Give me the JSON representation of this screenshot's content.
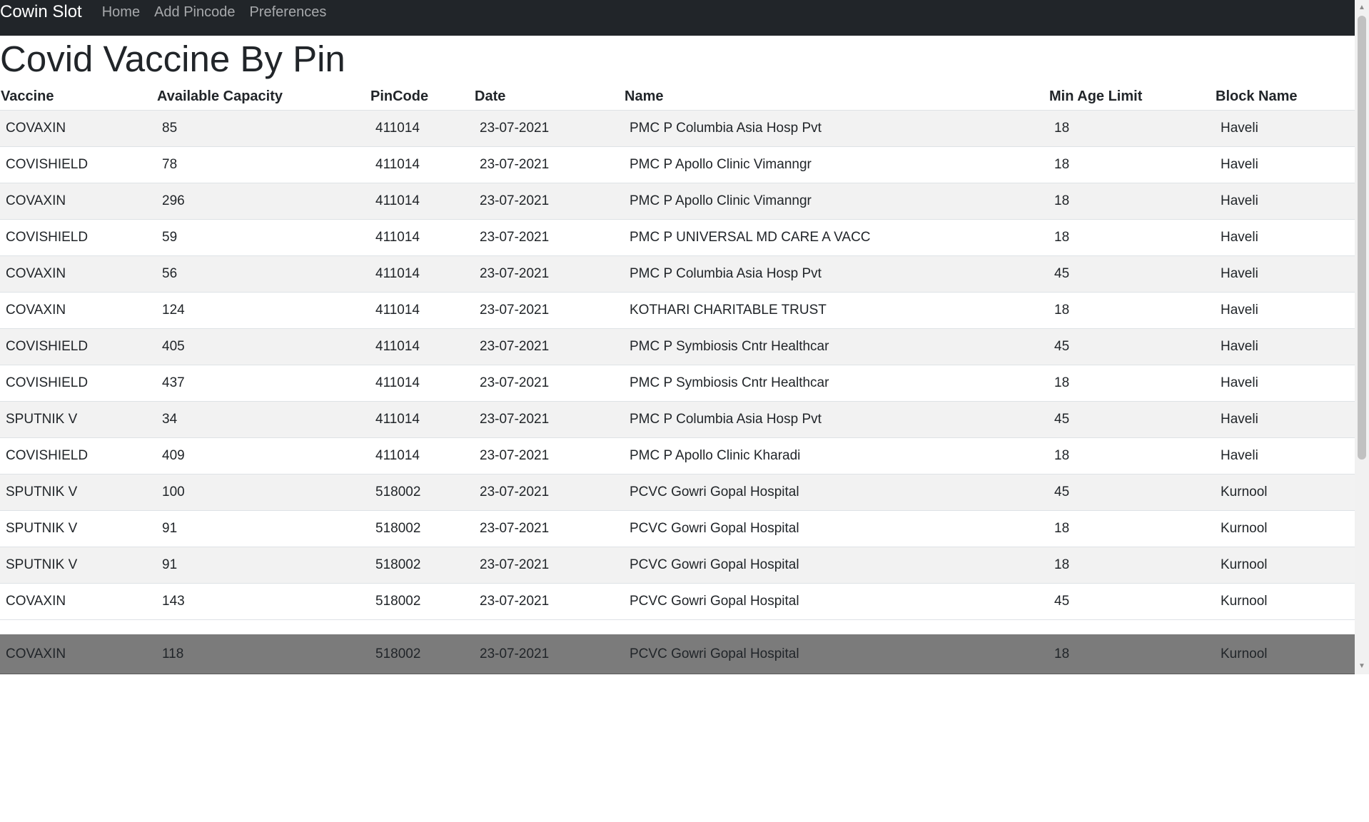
{
  "navbar": {
    "brand": "Cowin Slot",
    "links": [
      "Home",
      "Add Pincode",
      "Preferences"
    ]
  },
  "page_title": "Covid Vaccine By Pin",
  "table": {
    "headers": [
      "Vaccine",
      "Available Capacity",
      "PinCode",
      "Date",
      "Name",
      "Min Age Limit",
      "Block Name"
    ],
    "rows": [
      [
        "COVAXIN",
        "85",
        "411014",
        "23-07-2021",
        "PMC P Columbia Asia Hosp Pvt",
        "18",
        "Haveli"
      ],
      [
        "COVISHIELD",
        "78",
        "411014",
        "23-07-2021",
        "PMC P Apollo Clinic Vimanngr",
        "18",
        "Haveli"
      ],
      [
        "COVAXIN",
        "296",
        "411014",
        "23-07-2021",
        "PMC P Apollo Clinic Vimanngr",
        "18",
        "Haveli"
      ],
      [
        "COVISHIELD",
        "59",
        "411014",
        "23-07-2021",
        "PMC P UNIVERSAL MD CARE A VACC",
        "18",
        "Haveli"
      ],
      [
        "COVAXIN",
        "56",
        "411014",
        "23-07-2021",
        "PMC P Columbia Asia Hosp Pvt",
        "45",
        "Haveli"
      ],
      [
        "COVAXIN",
        "124",
        "411014",
        "23-07-2021",
        "KOTHARI CHARITABLE TRUST",
        "18",
        "Haveli"
      ],
      [
        "COVISHIELD",
        "405",
        "411014",
        "23-07-2021",
        "PMC P Symbiosis Cntr Healthcar",
        "45",
        "Haveli"
      ],
      [
        "COVISHIELD",
        "437",
        "411014",
        "23-07-2021",
        "PMC P Symbiosis Cntr Healthcar",
        "18",
        "Haveli"
      ],
      [
        "SPUTNIK V",
        "34",
        "411014",
        "23-07-2021",
        "PMC P Columbia Asia Hosp Pvt",
        "45",
        "Haveli"
      ],
      [
        "COVISHIELD",
        "409",
        "411014",
        "23-07-2021",
        "PMC P Apollo Clinic Kharadi",
        "18",
        "Haveli"
      ],
      [
        "SPUTNIK V",
        "100",
        "518002",
        "23-07-2021",
        "PCVC Gowri Gopal Hospital",
        "45",
        "Kurnool"
      ],
      [
        "SPUTNIK V",
        "91",
        "518002",
        "23-07-2021",
        "PCVC Gowri Gopal Hospital",
        "18",
        "Kurnool"
      ],
      [
        "SPUTNIK V",
        "91",
        "518002",
        "23-07-2021",
        "PCVC Gowri Gopal Hospital",
        "18",
        "Kurnool"
      ],
      [
        "COVAXIN",
        "143",
        "518002",
        "23-07-2021",
        "PCVC Gowri Gopal Hospital",
        "45",
        "Kurnool"
      ]
    ],
    "highlighted_row": [
      "COVAXIN",
      "118",
      "518002",
      "23-07-2021",
      "PCVC Gowri Gopal Hospital",
      "18",
      "Kurnool"
    ]
  },
  "icons": {
    "scroll_up": "scroll-up-arrow-icon",
    "scroll_down": "scroll-down-arrow-icon"
  },
  "colors": {
    "navbar_bg": "#212529",
    "brand_text": "#ffffff",
    "nav_link": "#a7a9ac",
    "stripe": "#f2f2f2",
    "highlight_row": "#7b7b7b"
  }
}
